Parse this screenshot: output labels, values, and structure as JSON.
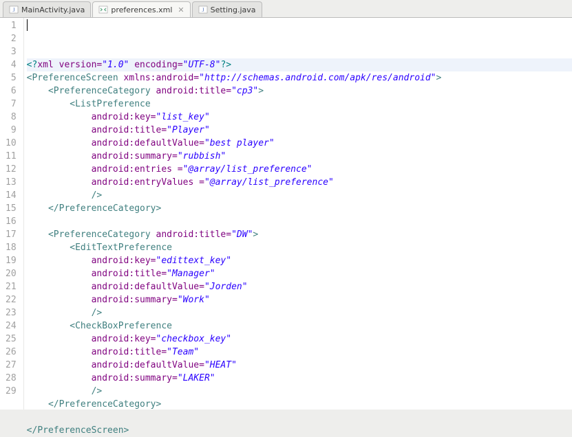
{
  "tabs": [
    {
      "name": "MainActivity.java",
      "active": false,
      "icon": "java"
    },
    {
      "name": "preferences.xml",
      "active": true,
      "icon": "xml"
    },
    {
      "name": "Setting.java",
      "active": false,
      "icon": "java"
    }
  ],
  "close_glyph": "✕",
  "lines": [
    {
      "n": 1,
      "hl": true,
      "segs": [
        {
          "t": "<?",
          "c": "pi"
        },
        {
          "t": "xml version=",
          "c": "attr"
        },
        {
          "t": "\"1.0\"",
          "c": "str"
        },
        {
          "t": " encoding=",
          "c": "attr"
        },
        {
          "t": "\"UTF-8\"",
          "c": "str"
        },
        {
          "t": "?>",
          "c": "pi"
        }
      ]
    },
    {
      "n": 2,
      "segs": [
        {
          "t": "<",
          "c": "tag"
        },
        {
          "t": "PreferenceScreen",
          "c": "tag"
        },
        {
          "t": " "
        },
        {
          "t": "xmlns:android=",
          "c": "attr"
        },
        {
          "t": "\"http://schemas.android.com/apk/res/android\"",
          "c": "str"
        },
        {
          "t": ">",
          "c": "tag"
        }
      ]
    },
    {
      "n": 3,
      "segs": [
        {
          "t": "    "
        },
        {
          "t": "<",
          "c": "tag"
        },
        {
          "t": "PreferenceCategory",
          "c": "tag"
        },
        {
          "t": " "
        },
        {
          "t": "android:title=",
          "c": "attr"
        },
        {
          "t": "\"cp3\"",
          "c": "str"
        },
        {
          "t": ">",
          "c": "tag"
        }
      ]
    },
    {
      "n": 4,
      "segs": [
        {
          "t": "        "
        },
        {
          "t": "<",
          "c": "tag"
        },
        {
          "t": "ListPreference",
          "c": "tag"
        }
      ]
    },
    {
      "n": 5,
      "segs": [
        {
          "t": "            "
        },
        {
          "t": "android:key=",
          "c": "attr"
        },
        {
          "t": "\"list_key\"",
          "c": "str"
        }
      ]
    },
    {
      "n": 6,
      "segs": [
        {
          "t": "            "
        },
        {
          "t": "android:title=",
          "c": "attr"
        },
        {
          "t": "\"Player\"",
          "c": "str"
        }
      ]
    },
    {
      "n": 7,
      "segs": [
        {
          "t": "            "
        },
        {
          "t": "android:defaultValue=",
          "c": "attr"
        },
        {
          "t": "\"best player\"",
          "c": "str"
        }
      ]
    },
    {
      "n": 8,
      "segs": [
        {
          "t": "            "
        },
        {
          "t": "android:summary=",
          "c": "attr"
        },
        {
          "t": "\"rubbish\"",
          "c": "str"
        }
      ]
    },
    {
      "n": 9,
      "segs": [
        {
          "t": "            "
        },
        {
          "t": "android:entries =",
          "c": "attr"
        },
        {
          "t": "\"@array/list_preference\"",
          "c": "str"
        }
      ]
    },
    {
      "n": 10,
      "segs": [
        {
          "t": "            "
        },
        {
          "t": "android:entryValues =",
          "c": "attr"
        },
        {
          "t": "\"@array/list_preference\"",
          "c": "str"
        }
      ]
    },
    {
      "n": 11,
      "segs": [
        {
          "t": "            "
        },
        {
          "t": "/>",
          "c": "tag"
        }
      ]
    },
    {
      "n": 12,
      "segs": [
        {
          "t": "    "
        },
        {
          "t": "</",
          "c": "tag"
        },
        {
          "t": "PreferenceCategory",
          "c": "tag"
        },
        {
          "t": ">",
          "c": "tag"
        }
      ]
    },
    {
      "n": 13,
      "segs": []
    },
    {
      "n": 14,
      "segs": [
        {
          "t": "    "
        },
        {
          "t": "<",
          "c": "tag"
        },
        {
          "t": "PreferenceCategory",
          "c": "tag"
        },
        {
          "t": " "
        },
        {
          "t": "android:title=",
          "c": "attr"
        },
        {
          "t": "\"DW\"",
          "c": "str"
        },
        {
          "t": ">",
          "c": "tag"
        }
      ]
    },
    {
      "n": 15,
      "segs": [
        {
          "t": "        "
        },
        {
          "t": "<",
          "c": "tag"
        },
        {
          "t": "EditTextPreference",
          "c": "tag"
        }
      ]
    },
    {
      "n": 16,
      "segs": [
        {
          "t": "            "
        },
        {
          "t": "android:key=",
          "c": "attr"
        },
        {
          "t": "\"edittext_key\"",
          "c": "str"
        }
      ]
    },
    {
      "n": 17,
      "segs": [
        {
          "t": "            "
        },
        {
          "t": "android:title=",
          "c": "attr"
        },
        {
          "t": "\"Manager\"",
          "c": "str"
        }
      ]
    },
    {
      "n": 18,
      "segs": [
        {
          "t": "            "
        },
        {
          "t": "android:defaultValue=",
          "c": "attr"
        },
        {
          "t": "\"Jorden\"",
          "c": "str"
        }
      ]
    },
    {
      "n": 19,
      "segs": [
        {
          "t": "            "
        },
        {
          "t": "android:summary=",
          "c": "attr"
        },
        {
          "t": "\"Work\"",
          "c": "str"
        }
      ]
    },
    {
      "n": 20,
      "segs": [
        {
          "t": "            "
        },
        {
          "t": "/>",
          "c": "tag"
        }
      ]
    },
    {
      "n": 21,
      "segs": [
        {
          "t": "        "
        },
        {
          "t": "<",
          "c": "tag"
        },
        {
          "t": "CheckBoxPreference",
          "c": "tag"
        }
      ]
    },
    {
      "n": 22,
      "segs": [
        {
          "t": "            "
        },
        {
          "t": "android:key=",
          "c": "attr"
        },
        {
          "t": "\"checkbox_key\"",
          "c": "str"
        }
      ]
    },
    {
      "n": 23,
      "segs": [
        {
          "t": "            "
        },
        {
          "t": "android:title=",
          "c": "attr"
        },
        {
          "t": "\"Team\"",
          "c": "str"
        }
      ]
    },
    {
      "n": 24,
      "segs": [
        {
          "t": "            "
        },
        {
          "t": "android:defaultValue=",
          "c": "attr"
        },
        {
          "t": "\"HEAT\"",
          "c": "str"
        }
      ]
    },
    {
      "n": 25,
      "segs": [
        {
          "t": "            "
        },
        {
          "t": "android:summary=",
          "c": "attr"
        },
        {
          "t": "\"LAKER\"",
          "c": "str"
        }
      ]
    },
    {
      "n": 26,
      "segs": [
        {
          "t": "            "
        },
        {
          "t": "/>",
          "c": "tag"
        }
      ]
    },
    {
      "n": 27,
      "segs": [
        {
          "t": "    "
        },
        {
          "t": "</",
          "c": "tag"
        },
        {
          "t": "PreferenceCategory",
          "c": "tag"
        },
        {
          "t": ">",
          "c": "tag"
        }
      ]
    },
    {
      "n": 28,
      "segs": []
    },
    {
      "n": 29,
      "segs": [
        {
          "t": "</",
          "c": "tag"
        },
        {
          "t": "PreferenceScreen",
          "c": "tag"
        },
        {
          "t": ">",
          "c": "tag"
        }
      ]
    }
  ]
}
